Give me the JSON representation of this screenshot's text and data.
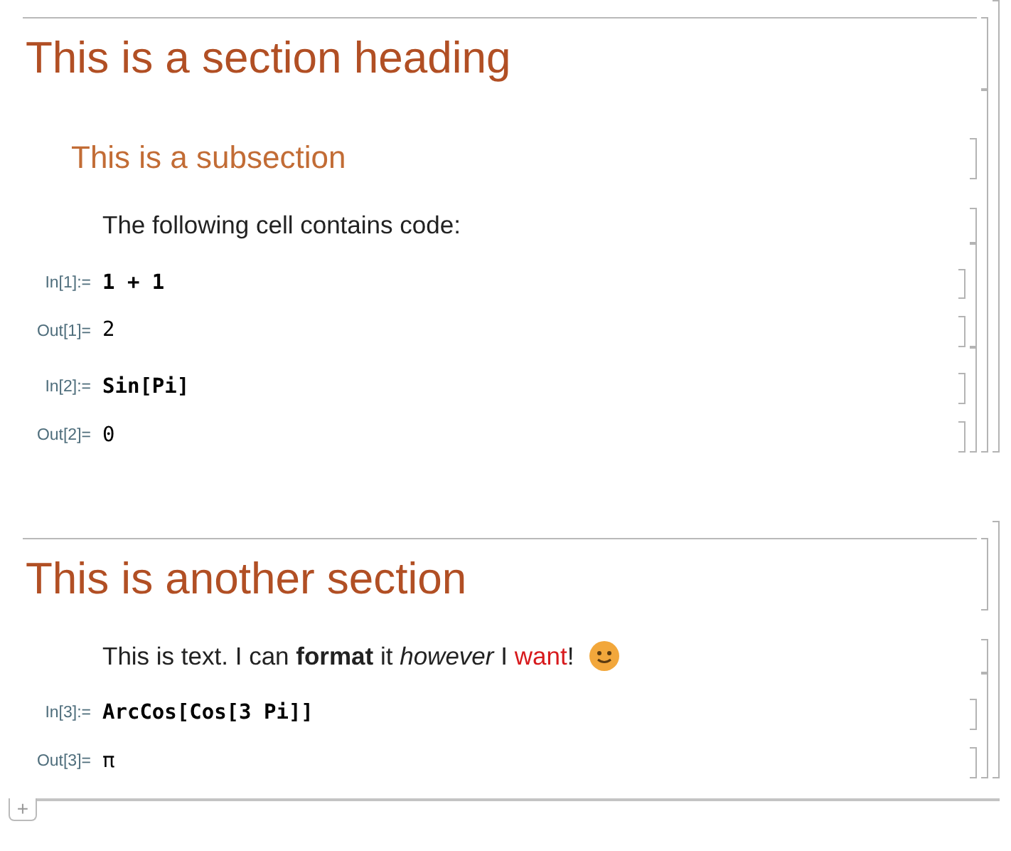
{
  "cells": [
    {
      "kind": "section",
      "text": "This is a section heading",
      "children": [
        {
          "kind": "subsection",
          "text": "This is a subsection",
          "children": [
            {
              "kind": "text",
              "runs": [
                {
                  "text": "The following cell contains code:"
                }
              ]
            },
            {
              "kind": "group",
              "children": [
                {
                  "kind": "input",
                  "label": "In[1]:=",
                  "code": "1 + 1"
                },
                {
                  "kind": "output",
                  "label": "Out[1]=",
                  "value": "2"
                }
              ]
            },
            {
              "kind": "group",
              "children": [
                {
                  "kind": "input",
                  "label": "In[2]:=",
                  "code": "Sin[Pi]"
                },
                {
                  "kind": "output",
                  "label": "Out[2]=",
                  "value": "0"
                }
              ]
            }
          ]
        }
      ]
    },
    {
      "kind": "section",
      "text": "This is another section",
      "children": [
        {
          "kind": "emoji_text",
          "runs": [
            {
              "text": "This is text. I can **format** it *however* I "
            },
            {
              "text": "want",
              "color": "#d7191c"
            },
            {
              "text": "!"
            }
          ]
        },
        {
          "kind": "group",
          "children": [
            {
              "kind": "input",
              "label": "In[3]:=",
              "code": "ArcCos[Cos[3 Pi]]"
            },
            {
              "kind": "output",
              "label": "Out[3]=",
              "value": "π"
            }
          ]
        }
      ]
    }
  ],
  "new_cell_button": "+"
}
